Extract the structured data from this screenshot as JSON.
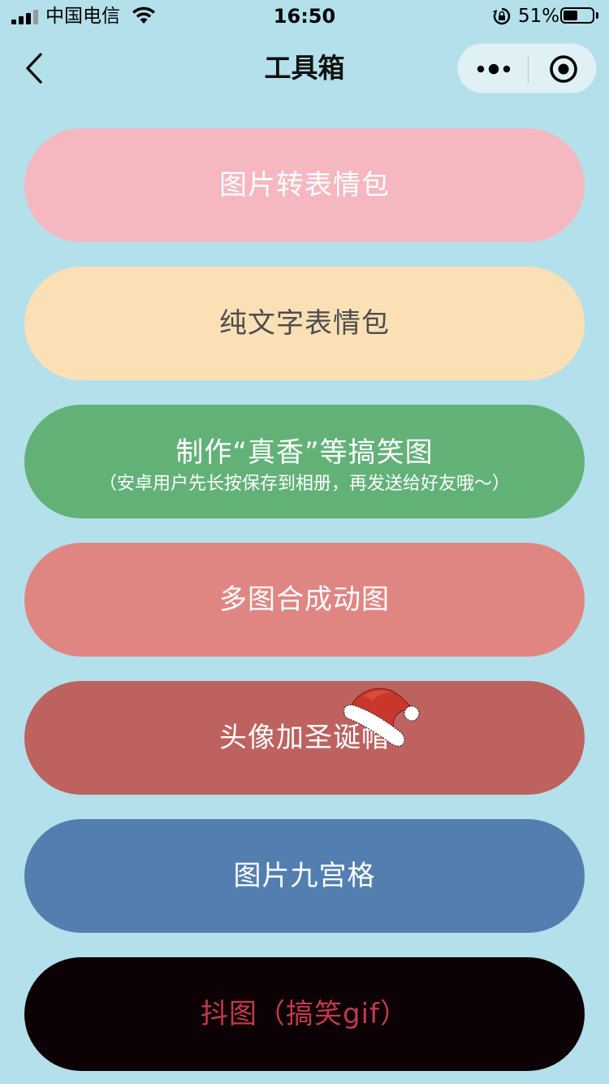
{
  "status_bar": {
    "carrier": "中国电信",
    "time": "16:50",
    "battery_percent": "51%",
    "battery_level": 0.51
  },
  "nav": {
    "title": "工具箱",
    "back_icon": "chevron-left-icon",
    "more_icon": "more-dots-icon",
    "close_icon": "target-close-icon"
  },
  "colors": {
    "background": "#b3e0ea",
    "btn_pink": "#f5b8c0",
    "btn_peach": "#fbe0b6",
    "btn_green": "#62b278",
    "btn_salmon": "#e08682",
    "btn_brick": "#bd625f",
    "btn_blue": "#537fb0",
    "btn_black": "#0c0205",
    "text_red": "#c23a4a"
  },
  "tools": [
    {
      "label": "图片转表情包"
    },
    {
      "label": "纯文字表情包"
    },
    {
      "label": "制作“真香”等搞笑图",
      "sublabel": "（安卓用户先长按保存到相册，再发送给好友哦～）"
    },
    {
      "label": "多图合成动图"
    },
    {
      "label": "头像加圣诞帽",
      "decoration": "santa-hat-icon"
    },
    {
      "label": "图片九宫格"
    },
    {
      "label": "抖图（搞笑gif）"
    }
  ]
}
